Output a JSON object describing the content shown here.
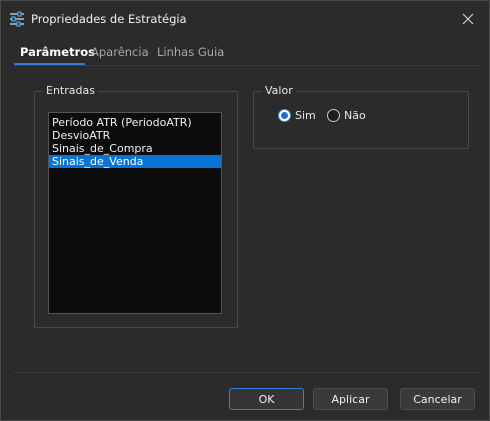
{
  "window": {
    "title": "Propriedades de Estratégia"
  },
  "tabs": [
    {
      "label": "Parâmetros",
      "active": true
    },
    {
      "label": "Aparência",
      "active": false
    },
    {
      "label": "Linhas Guia",
      "active": false
    }
  ],
  "entradas": {
    "label": "Entradas",
    "items": [
      {
        "label": "Período ATR (PeriodoATR)",
        "selected": false
      },
      {
        "label": "DesvioATR",
        "selected": false
      },
      {
        "label": "Sinais_de_Compra",
        "selected": false
      },
      {
        "label": "Sinais_de_Venda",
        "selected": true
      }
    ]
  },
  "valor": {
    "label": "Valor",
    "options": [
      {
        "label": "Sim",
        "checked": true
      },
      {
        "label": "Não",
        "checked": false
      }
    ]
  },
  "buttons": {
    "ok": "OK",
    "apply": "Aplicar",
    "cancel": "Cancelar"
  },
  "colors": {
    "accent": "#2d7fe0",
    "selection": "#0a74d6",
    "background": "#2b2b2b",
    "list_background": "#0d0d0d"
  },
  "icons": {
    "app": "sliders-icon",
    "close": "close-icon"
  }
}
